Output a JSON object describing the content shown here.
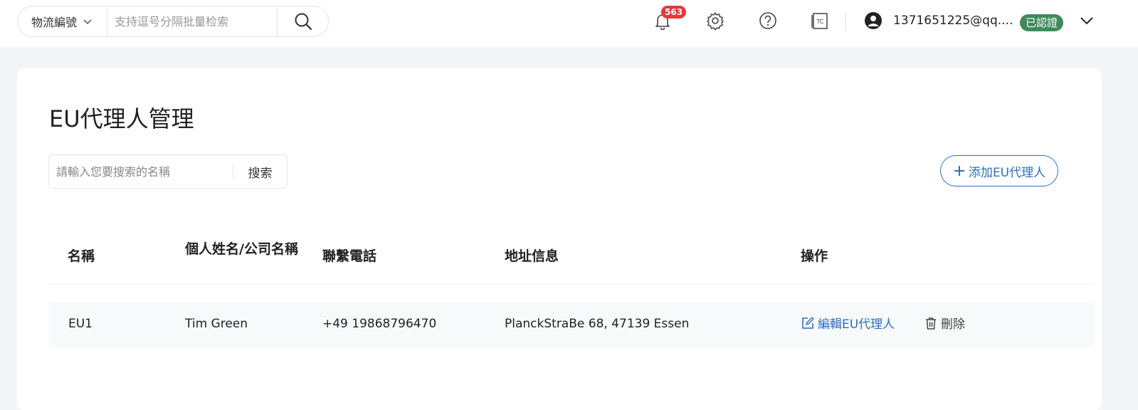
{
  "topbar": {
    "search_type": "物流編號",
    "search_placeholder": "支持逗号分隔批量检索",
    "notification_count": "563",
    "user_email": "1371651225@qq....",
    "verified_label": "已認證"
  },
  "page": {
    "title": "EU代理人管理",
    "search_placeholder": "請輸入您要搜索的名稱",
    "search_button": "搜索",
    "add_button": "添加EU代理人"
  },
  "table": {
    "headers": {
      "name": "名稱",
      "person": "個人姓名/公司名稱",
      "phone": "聯繫電話",
      "address": "地址信息",
      "actions": "操作"
    },
    "rows": [
      {
        "name": "EU1",
        "person": "Tim Green",
        "phone": "+49 19868796470",
        "address": "PlanckStraBe 68, 47139 Essen",
        "edit_label": "編輯EU代理人",
        "delete_label": "刪除"
      }
    ]
  },
  "colors": {
    "accent": "#2b6fc9",
    "verified": "#3d8a5b",
    "badge": "#e53935"
  }
}
